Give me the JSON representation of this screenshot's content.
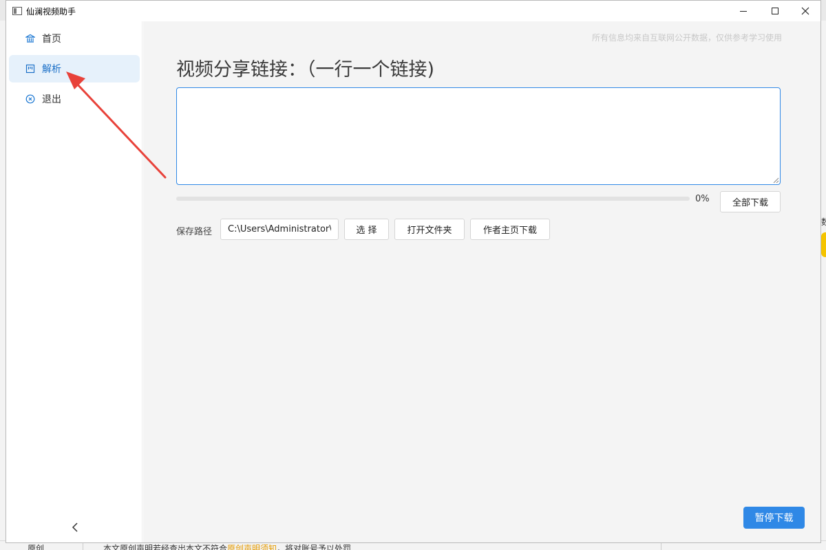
{
  "window": {
    "title": "仙澜视频助手"
  },
  "sidebar": {
    "items": [
      {
        "label": "首页",
        "icon": "bank-icon"
      },
      {
        "label": "解析",
        "icon": "frame-icon",
        "active": true
      },
      {
        "label": "退出",
        "icon": "close-circle-icon"
      }
    ],
    "collapse": "<"
  },
  "main": {
    "disclaimer": "所有信息均来自互联网公开数据，仅供参考学习使用",
    "heading": "视频分享链接：（一行一个链接)",
    "link_input": {
      "value": "",
      "placeholder": ""
    },
    "progress": {
      "percent": 0,
      "label": "0%"
    },
    "download_all": "全部下载",
    "save_path_label": "保存路径",
    "save_path_value": "C:\\Users\\Administrator\\[",
    "select": "选 择",
    "open_folder": "打开文件夹",
    "author_download": "作者主页下载",
    "pause_download": "暂停下载"
  },
  "background": {
    "bottom_left": "原创",
    "bottom_text_prefix": "本文原创声明若经查出本文不符合",
    "bottom_text_link": "原创声明须知",
    "bottom_text_suffix": "，将对账号予以处罚",
    "right_edge": "数"
  },
  "colors": {
    "accent": "#2f88e6",
    "active_bg": "#e6f1fb",
    "arrow": "#e8423a"
  }
}
